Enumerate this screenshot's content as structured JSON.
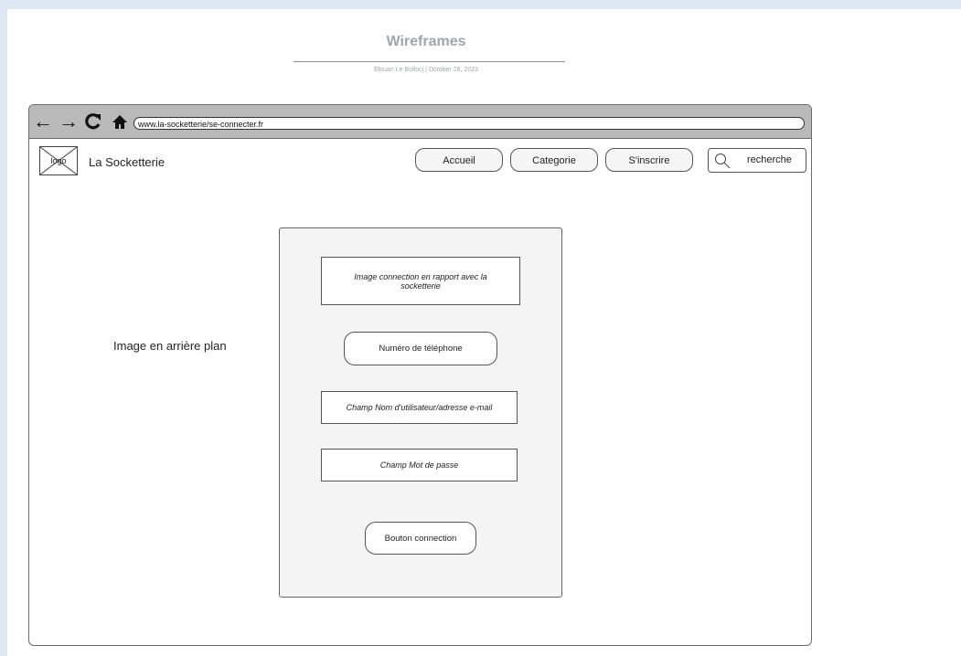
{
  "document": {
    "title": "Wireframes",
    "meta": "Elouan Le Bollocj  |  October 28, 2023"
  },
  "browser": {
    "url": "www.la-socketterie/se-connecter.fr",
    "icons": {
      "back": "arrow-left-icon",
      "forward": "arrow-right-icon",
      "reload": "reload-icon",
      "home": "home-icon"
    }
  },
  "header": {
    "logo_text": "logo",
    "site_name": "La Socketterie",
    "nav": [
      {
        "label": "Accueil"
      },
      {
        "label": "Categorie"
      },
      {
        "label": "S'inscrire"
      }
    ],
    "search": {
      "label": "recherche",
      "icon": "search-icon"
    }
  },
  "main": {
    "background_label": "Image en arrière plan",
    "form": {
      "image_placeholder": "Image connection en rapport avec la socketterie",
      "phone_button": "Numéro de téléphone",
      "username_field": "Champ Nom d'utilisateur/adresse e-mail",
      "password_field": "Champ Mot de passe",
      "submit_button": "Bouton connection"
    }
  }
}
